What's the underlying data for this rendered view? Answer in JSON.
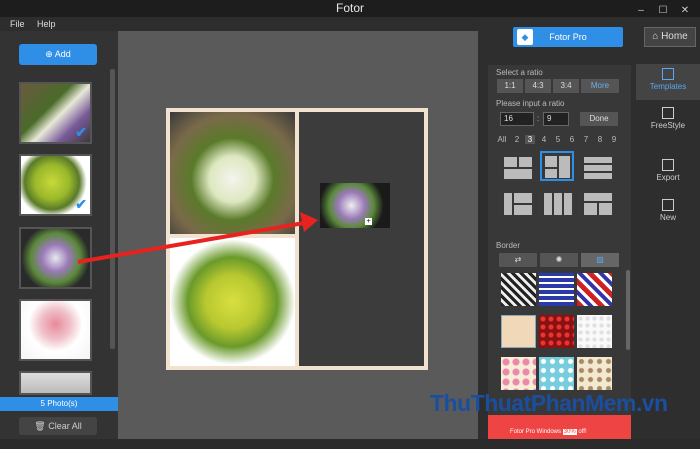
{
  "window": {
    "title": "Fotor",
    "minimize": "–",
    "maximize": "☐",
    "close": "✕"
  },
  "menu": {
    "file": "File",
    "help": "Help"
  },
  "left_panel": {
    "add_label": "Add",
    "photo_count": "5 Photo(s)",
    "clear_all_label": "Clear All"
  },
  "right_panel": {
    "fotor_pro_label": "Fotor Pro",
    "home_label": "Home",
    "select_ratio_label": "Select a ratio",
    "ratios": [
      "1:1",
      "4:3",
      "3:4"
    ],
    "more_label": "More",
    "input_ratio_label": "Please input a ratio",
    "ratio_width": "16",
    "ratio_separator": ":",
    "ratio_height": "9",
    "done_label": "Done",
    "counts": [
      "All",
      "2",
      "3",
      "4",
      "5",
      "6",
      "7",
      "8",
      "9"
    ],
    "border_label": "Border"
  },
  "side_nav": {
    "templates": "Templates",
    "freestyle": "FreeStyle",
    "export": "Export",
    "new": "New"
  },
  "promo": {
    "text": "Fotor Pro Windows",
    "badge": "30%",
    "suffix": "off!"
  },
  "watermark": "ThuThuatPhanMem.vn",
  "colors": {
    "accent": "#2f8fe6",
    "arrow": "#e8231f"
  }
}
